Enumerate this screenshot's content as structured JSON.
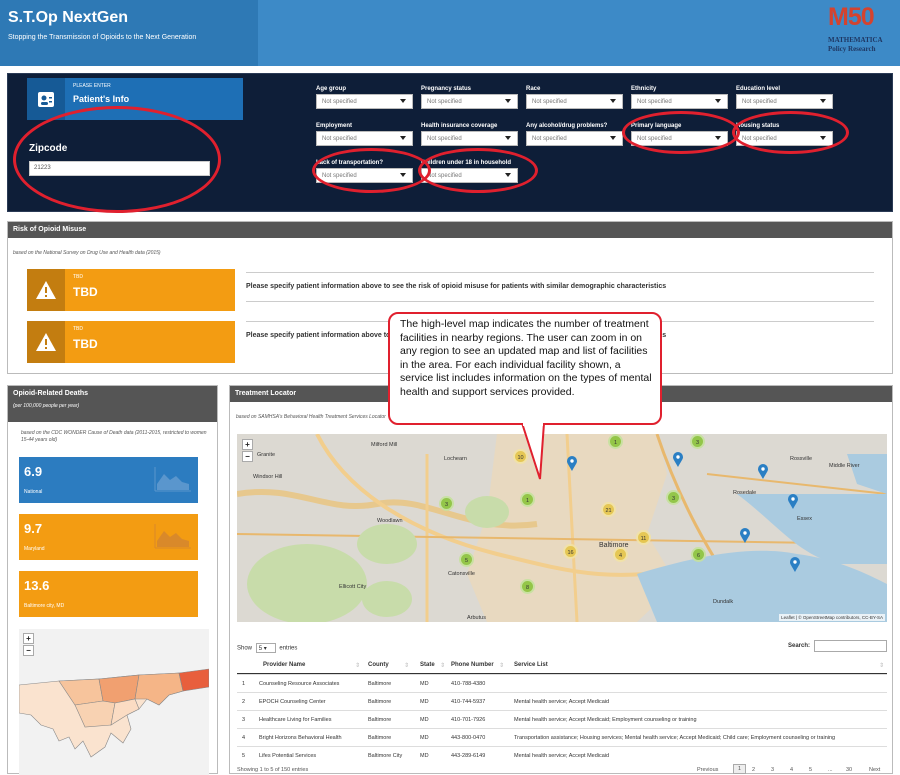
{
  "header": {
    "title": "S.T.Op NextGen",
    "subtitle": "Stopping the Transmission of Opioids to the Next Generation",
    "logo_mark": "M50",
    "logo_line1": "MATHEMATICA",
    "logo_line2": "Policy Research"
  },
  "patient": {
    "small": "PLEASE ENTER",
    "title": "Patient's Info",
    "zip_label": "Zipcode",
    "zip_value": "21223"
  },
  "filters": [
    {
      "label": "Age group",
      "value": "Not specified"
    },
    {
      "label": "Pregnancy status",
      "value": "Not specified"
    },
    {
      "label": "Race",
      "value": "Not specified"
    },
    {
      "label": "Ethnicity",
      "value": "Not specified"
    },
    {
      "label": "Education level",
      "value": "Not specified"
    },
    {
      "label": "Employment",
      "value": "Not specified"
    },
    {
      "label": "Health insurance coverage",
      "value": "Not specified"
    },
    {
      "label": "Any alcohol/drug problems?",
      "value": "Not specified"
    },
    {
      "label": "Primary language",
      "value": "Not specified"
    },
    {
      "label": "Housing status",
      "value": "Not specified"
    },
    {
      "label": "Lack of transportation?",
      "value": "Not specified"
    },
    {
      "label": "Children under 18 in household",
      "value": "Not specified"
    }
  ],
  "risk": {
    "title": "Risk of Opioid Misuse",
    "source": "based on the National Survey on Drug Use and Health data (2015)",
    "cards": [
      {
        "small": "TBD",
        "big": "TBD",
        "message": "Please specify patient information above to see the risk of opioid misuse for patients with similar demographic characteristics"
      },
      {
        "small": "TBD",
        "big": "TBD",
        "message": "Please specify patient information above to see the risk of opioid misuse for patients with similar demographic characteristics"
      }
    ]
  },
  "deaths": {
    "title": "Opioid-Related Deaths",
    "subtitle": "(per 100,000 people per year)",
    "source": "based on the CDC WONDER Cause of Death data (2011-2015, restricted to women 15-44 years old)",
    "cards": [
      {
        "value": "6.9",
        "label": "National",
        "color": "#2c7cc0"
      },
      {
        "value": "9.7",
        "label": "Maryland",
        "color": "#f39c12"
      },
      {
        "value": "13.6",
        "label": "Baltimore city, MD",
        "color": "#f39c12"
      }
    ]
  },
  "locator": {
    "title": "Treatment Locator",
    "source": "based on SAMHSA's Behavioral Health Treatment Services Locator",
    "attribution": "Leaflet | © OpenStreetMap contributors, CC-BY-SA",
    "map_labels": [
      "Milford Mill",
      "Lochearn",
      "Woodlawn",
      "Catonsville",
      "Ellicott City",
      "Baltimore",
      "Rosedale",
      "Essex",
      "Rossville",
      "Middle River",
      "Dundalk",
      "Arbutus",
      "Granite",
      "Windsor Hill"
    ],
    "clusters": [
      "10",
      "1",
      "3",
      "1",
      "3",
      "5",
      "21",
      "11",
      "16",
      "4",
      "6",
      "8",
      "3"
    ],
    "table": {
      "show_label": "Show",
      "show_value": "5",
      "entries_label": "entries",
      "search_label": "Search:",
      "columns": [
        "Provider Name",
        "County",
        "State",
        "Phone Number",
        "Service List"
      ],
      "rows": [
        {
          "n": "1",
          "name": "Counseling Resource Associates",
          "county": "Baltimore",
          "state": "MD",
          "phone": "410-788-4380",
          "services": ""
        },
        {
          "n": "2",
          "name": "EPOCH Counseling Center",
          "county": "Baltimore",
          "state": "MD",
          "phone": "410-744-5937",
          "services": "Mental health service; Accept Medicaid"
        },
        {
          "n": "3",
          "name": "Healthcare Living for Families",
          "county": "Baltimore",
          "state": "MD",
          "phone": "410-701-7926",
          "services": "Mental health service; Accept Medicaid; Employment counseling or training"
        },
        {
          "n": "4",
          "name": "Bright Horizons Behavioral Health",
          "county": "Baltimore",
          "state": "MD",
          "phone": "443-800-0470",
          "services": "Transportation assistance; Housing services; Mental health service; Accept Medicaid; Child care; Employment counseling or training"
        },
        {
          "n": "5",
          "name": "Lifes Potential Services",
          "county": "Baltimore City",
          "state": "MD",
          "phone": "443-289-6149",
          "services": "Mental health service; Accept Medicaid"
        }
      ],
      "info": "Showing 1 to 5 of 150 entries",
      "pages": [
        "Previous",
        "1",
        "2",
        "3",
        "4",
        "5",
        "...",
        "30",
        "Next"
      ]
    }
  },
  "callout": "The high-level map indicates the number of treatment facilities in nearby regions. The user can zoom in on any region to see an updated map and list of facilities in the area. For each individual facility shown, a service list includes information on the types of mental health and support services provided."
}
